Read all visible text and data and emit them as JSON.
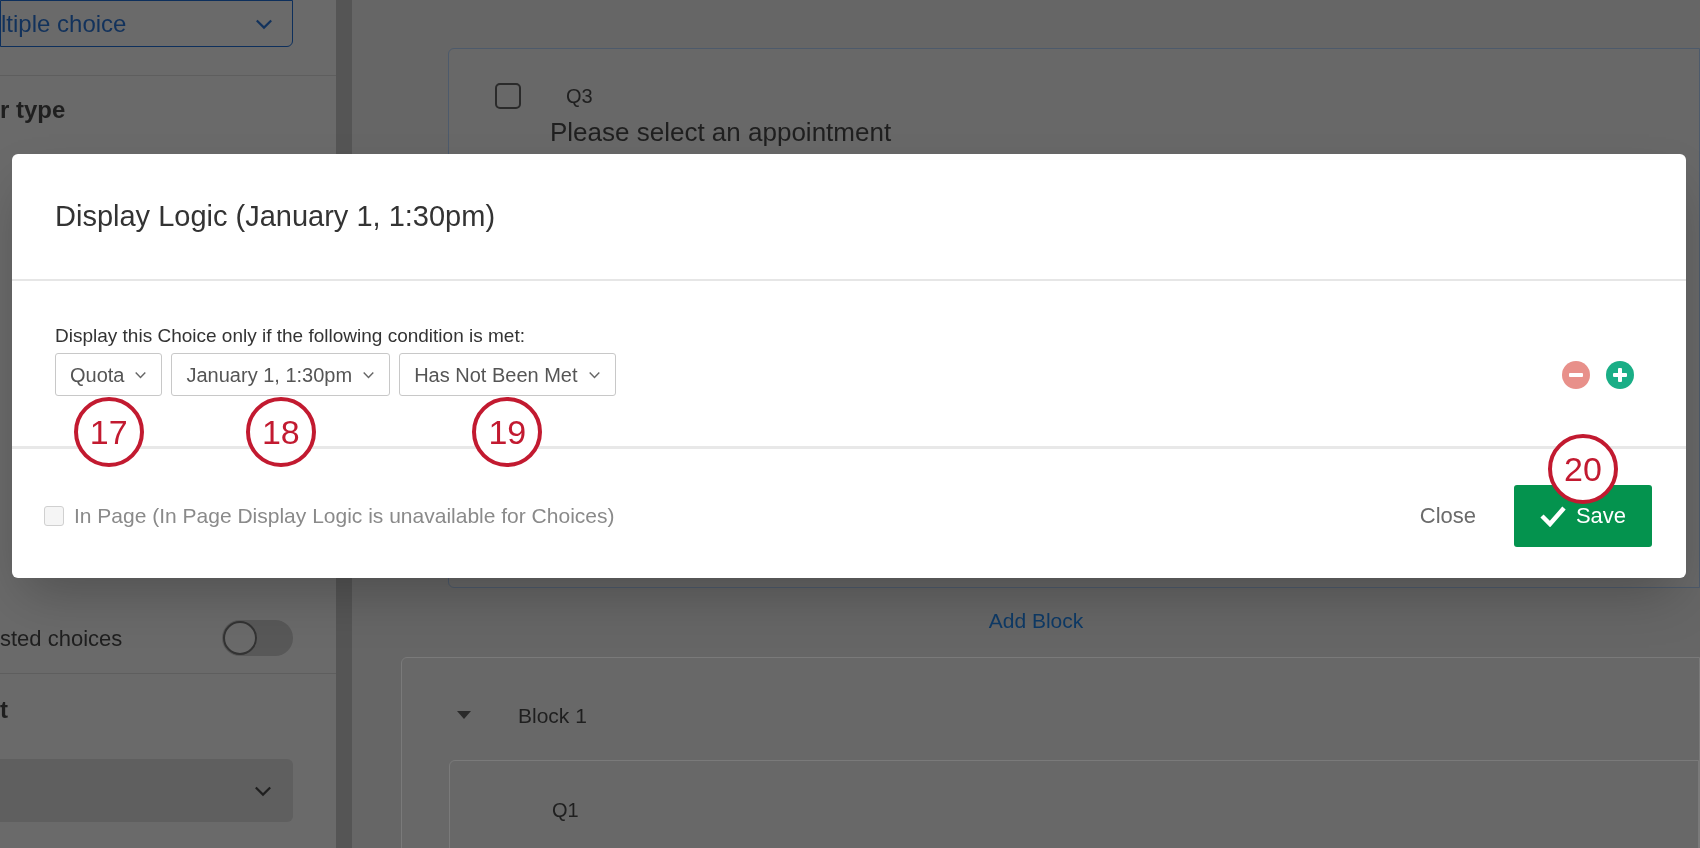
{
  "sidebar": {
    "type_dropdown": "ltiple choice",
    "heading_1": "r type",
    "toggle_row": {
      "label": "sted choices",
      "on": false
    },
    "heading_2": "t"
  },
  "editor": {
    "question_card": {
      "number": "Q3",
      "checked": false,
      "text": "Please select an appointment"
    },
    "add_block": "Add Block",
    "block": {
      "title": "Block 1",
      "expanded": true,
      "question": "Q1"
    }
  },
  "dialog": {
    "title": "Display Logic (January 1, 1:30pm)",
    "condition_label": "Display this Choice only if the following condition is met:",
    "conditions": [
      {
        "dropdowns": [
          {
            "value": "Quota",
            "callout": "17"
          },
          {
            "value": "January 1, 1:30pm",
            "callout": "18"
          },
          {
            "value": "Has Not Been Met",
            "callout": "19"
          }
        ]
      }
    ],
    "in_page": {
      "label": "In Page (In Page Display Logic is unavailable for Choices)",
      "checked": false,
      "disabled": true
    },
    "close": "Close",
    "save": {
      "label": "Save",
      "callout": "20"
    }
  }
}
